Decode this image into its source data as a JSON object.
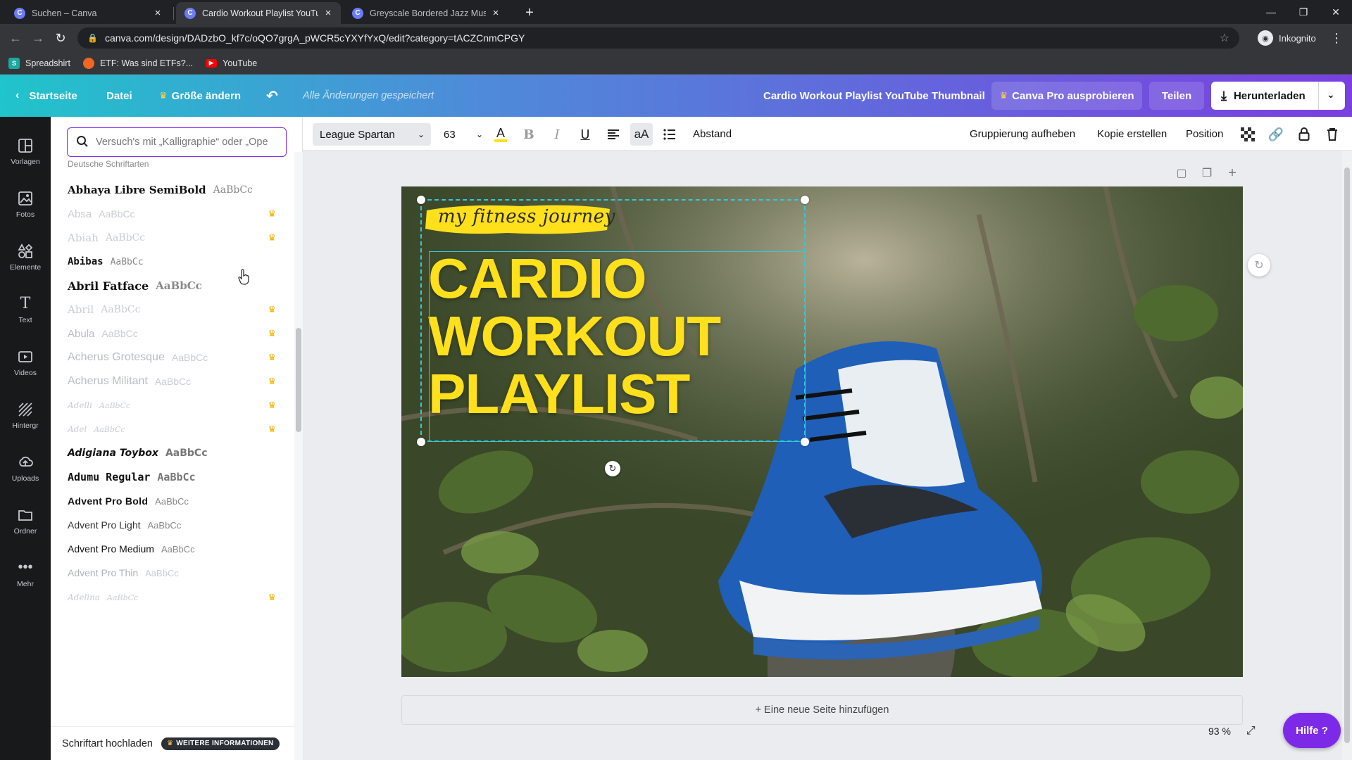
{
  "browser": {
    "tabs": [
      {
        "label": "Suchen – Canva",
        "active": false
      },
      {
        "label": "Cardio Workout Playlist YouTube",
        "active": true
      },
      {
        "label": "Greyscale Bordered Jazz Music Y",
        "active": false
      }
    ],
    "tab_favicon": "C",
    "url": "canva.com/design/DADzbO_kf7c/oQO7grgA_pWCR5cYXYfYxQ/edit?category=tACZCnmCPGY",
    "incognito_label": "Inkognito",
    "bookmarks": [
      {
        "label": "Spreadshirt",
        "color": "#1aa9a0"
      },
      {
        "label": "ETF: Was sind ETFs?...",
        "color": "#f26522"
      },
      {
        "label": "YouTube",
        "color": "#ff0000"
      }
    ]
  },
  "header": {
    "home": "Startseite",
    "file": "Datei",
    "resize": "Größe ändern",
    "saved": "Alle Änderungen gespeichert",
    "design_title": "Cardio Workout Playlist YouTube Thumbnail",
    "pro_trial": "Canva Pro ausprobieren",
    "share": "Teilen",
    "download": "Herunterladen"
  },
  "rail": [
    {
      "label": "Vorlagen",
      "icon": "templates-icon"
    },
    {
      "label": "Fotos",
      "icon": "photos-icon"
    },
    {
      "label": "Elemente",
      "icon": "elements-icon"
    },
    {
      "label": "Text",
      "icon": "text-icon"
    },
    {
      "label": "Videos",
      "icon": "videos-icon"
    },
    {
      "label": "Hintergr",
      "icon": "background-icon"
    },
    {
      "label": "Uploads",
      "icon": "uploads-icon"
    },
    {
      "label": "Ordner",
      "icon": "folder-icon"
    },
    {
      "label": "Mehr",
      "icon": "more-icon"
    }
  ],
  "font_panel": {
    "search_placeholder": "Versuch's mit „Kalligraphie“ oder „Ope",
    "section_title": "Deutsche Schriftarten",
    "fonts": [
      {
        "name": "Abhaya Libre SemiBold",
        "sample": "AaBbCc",
        "pro": false,
        "faded": false
      },
      {
        "name": "Absa",
        "sample": "AaBbCc",
        "pro": true,
        "faded": true
      },
      {
        "name": "Abiah",
        "sample": "AaBbCc",
        "pro": true,
        "faded": true
      },
      {
        "name": "Abibas",
        "sample": "AaBbCc",
        "pro": false,
        "faded": false
      },
      {
        "name": "Abril Fatface",
        "sample": "AaBbCc",
        "pro": false,
        "faded": false
      },
      {
        "name": "Abril",
        "sample": "AaBbCc",
        "pro": true,
        "faded": true
      },
      {
        "name": "Abula",
        "sample": "AaBbCc",
        "pro": true,
        "faded": true
      },
      {
        "name": "Acherus Grotesque",
        "sample": "AaBbCc",
        "pro": true,
        "faded": true
      },
      {
        "name": "Acherus Militant",
        "sample": "AaBbCc",
        "pro": true,
        "faded": true
      },
      {
        "name": "Adelli",
        "sample": "AaBbCc",
        "pro": true,
        "faded": true
      },
      {
        "name": "Adel",
        "sample": "AaBbCc",
        "pro": true,
        "faded": true
      },
      {
        "name": "Adigiana Toybox",
        "sample": "AaBbCc",
        "pro": false,
        "faded": false
      },
      {
        "name": "Adumu Regular",
        "sample": "AaBbCc",
        "pro": false,
        "faded": false
      },
      {
        "name": "Advent Pro Bold",
        "sample": "AaBbCc",
        "pro": false,
        "faded": false
      },
      {
        "name": "Advent Pro Light",
        "sample": "AaBbCc",
        "pro": false,
        "faded": false
      },
      {
        "name": "Advent Pro Medium",
        "sample": "AaBbCc",
        "pro": false,
        "faded": false
      },
      {
        "name": "Advent Pro Thin",
        "sample": "AaBbCc",
        "pro": false,
        "faded": true
      },
      {
        "name": "Adelina",
        "sample": "AaBbCc",
        "pro": true,
        "faded": true
      }
    ],
    "upload_label": "Schriftart hochladen",
    "more_info": "WEITERE INFORMATIONEN"
  },
  "edit_toolbar": {
    "font": "League Spartan",
    "size": "63",
    "spacing": "Abstand",
    "ungroup": "Gruppierung aufheben",
    "duplicate": "Kopie erstellen",
    "position": "Position"
  },
  "design": {
    "subtitle": "my fitness journey",
    "headline": [
      "CARDIO",
      "WORKOUT",
      "PLAYLIST"
    ],
    "accent_color": "#ffe01b"
  },
  "add_page": "+ Eine neue Seite hinzufügen",
  "zoom": "93 %",
  "help": "Hilfe ?"
}
